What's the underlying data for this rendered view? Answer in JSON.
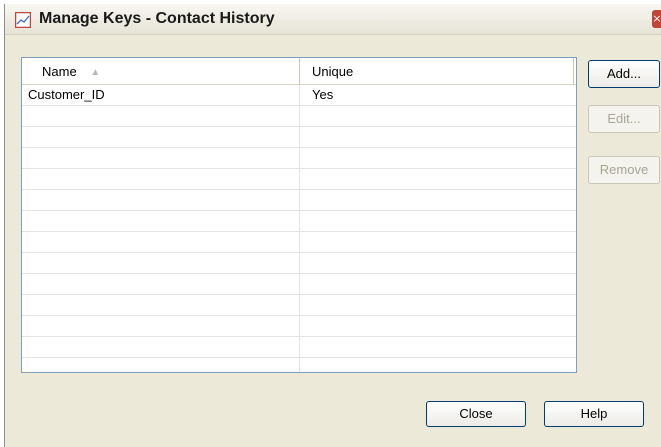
{
  "window": {
    "title": "Manage Keys - Contact History",
    "close_glyph": "×",
    "icon": "chart-line-icon",
    "accent_color": "#c0463a"
  },
  "table": {
    "columns": [
      {
        "label": "Name",
        "sort": "ascending"
      },
      {
        "label": "Unique"
      }
    ],
    "rows": [
      {
        "name": "Customer_ID",
        "unique": "Yes"
      },
      {
        "name": "",
        "unique": ""
      },
      {
        "name": "",
        "unique": ""
      },
      {
        "name": "",
        "unique": ""
      },
      {
        "name": "",
        "unique": ""
      },
      {
        "name": "",
        "unique": ""
      },
      {
        "name": "",
        "unique": ""
      },
      {
        "name": "",
        "unique": ""
      },
      {
        "name": "",
        "unique": ""
      },
      {
        "name": "",
        "unique": ""
      },
      {
        "name": "",
        "unique": ""
      },
      {
        "name": "",
        "unique": ""
      },
      {
        "name": "",
        "unique": ""
      },
      {
        "name": "",
        "unique": ""
      }
    ]
  },
  "side_buttons": {
    "add": "Add...",
    "edit": "Edit...",
    "remove": "Remove"
  },
  "footer_buttons": {
    "close": "Close",
    "help": "Help"
  }
}
